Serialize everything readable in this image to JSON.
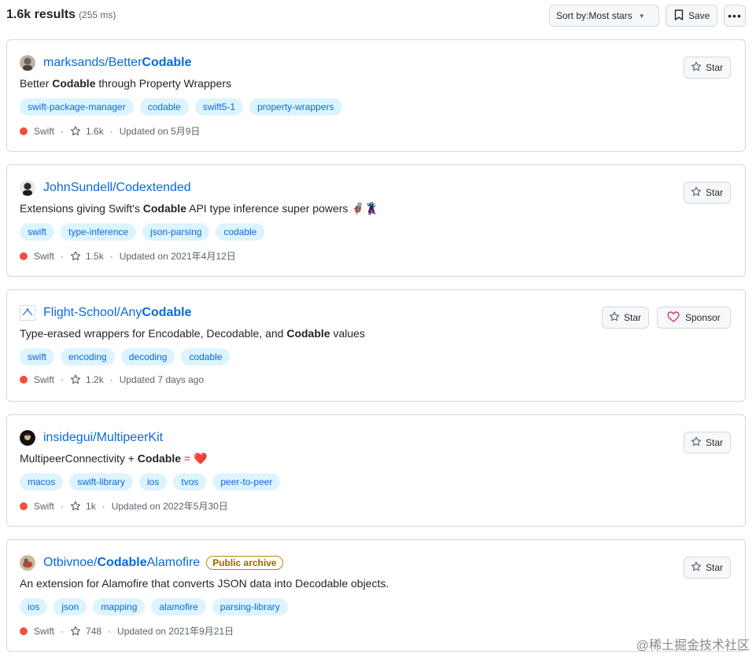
{
  "header": {
    "results_count": "1.6k results",
    "results_time": "(255 ms)",
    "sort_prefix": "Sort by:",
    "sort_value": "Most stars",
    "save_label": "Save"
  },
  "repos": [
    {
      "owner": "marksands/",
      "name_plain": "Better",
      "name_bold": "Codable",
      "name_suffix": "",
      "desc_pre": "Better ",
      "desc_bold": "Codable",
      "desc_post": " through Property Wrappers",
      "topics": [
        "swift-package-manager",
        "codable",
        "swift5-1",
        "property-wrappers"
      ],
      "language": "Swift",
      "stars": "1.6k",
      "updated": "Updated on 5月9日",
      "star_label": "Star"
    },
    {
      "owner": "JohnSundell/",
      "name_plain": "Codextended",
      "name_bold": "",
      "name_suffix": "",
      "desc_pre": "Extensions giving Swift's ",
      "desc_bold": "Codable",
      "desc_post": " API type inference super powers 🦸‍♂️🦹‍♀️",
      "topics": [
        "swift",
        "type-inference",
        "json-parsing",
        "codable"
      ],
      "language": "Swift",
      "stars": "1.5k",
      "updated": "Updated on 2021年4月12日",
      "star_label": "Star"
    },
    {
      "owner": "Flight-School/",
      "name_plain": "Any",
      "name_bold": "Codable",
      "name_suffix": "",
      "desc_pre": "Type-erased wrappers for Encodable, Decodable, and ",
      "desc_bold": "Codable",
      "desc_post": " values",
      "topics": [
        "swift",
        "encoding",
        "decoding",
        "codable"
      ],
      "language": "Swift",
      "stars": "1.2k",
      "updated": "Updated 7 days ago",
      "star_label": "Star",
      "sponsor_label": "Sponsor"
    },
    {
      "owner": "insidegui/",
      "name_plain": "MultipeerKit",
      "name_bold": "",
      "name_suffix": "",
      "desc_pre": "MultipeerConnectivity + ",
      "desc_bold": "Codable",
      "desc_post": " = ❤️",
      "topics": [
        "macos",
        "swift-library",
        "ios",
        "tvos",
        "peer-to-peer"
      ],
      "language": "Swift",
      "stars": "1k",
      "updated": "Updated on 2022年5月30日",
      "star_label": "Star"
    },
    {
      "owner": "Otbivnoe/",
      "name_plain": "",
      "name_bold": "Codable",
      "name_suffix": "Alamofire",
      "badge": "Public archive",
      "desc_pre": "An extension for Alamofire that converts JSON data into Decodable objects.",
      "desc_bold": "",
      "desc_post": "",
      "topics": [
        "ios",
        "json",
        "mapping",
        "alamofire",
        "parsing-library"
      ],
      "language": "Swift",
      "stars": "748",
      "updated": "Updated on 2021年9月21日",
      "star_label": "Star"
    }
  ],
  "watermark": "@稀土掘金技术社区",
  "colors": {
    "link": "#0969da",
    "topic_bg": "#ddf4ff",
    "swift": "#F05138"
  }
}
